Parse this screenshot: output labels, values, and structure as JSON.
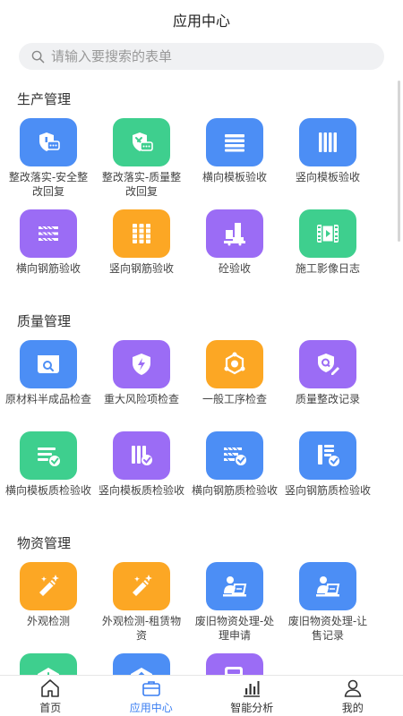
{
  "header": {
    "title": "应用中心"
  },
  "search": {
    "placeholder": "请输入要搜索的表单"
  },
  "sections": [
    {
      "title": "生产管理",
      "items": [
        {
          "label": "整改落实-安全整改回复",
          "icon": "shield-chat-icon",
          "color": "#4c8ef5"
        },
        {
          "label": "整改落实-质量整改回复",
          "icon": "tools-chat-icon",
          "color": "#3ecf8e"
        },
        {
          "label": "横向模板验收",
          "icon": "horizontal-lines-icon",
          "color": "#4c8ef5"
        },
        {
          "label": "竖向模板验收",
          "icon": "vertical-lines-icon",
          "color": "#4c8ef5"
        },
        {
          "label": "横向钢筋验收",
          "icon": "rebar-horizontal-icon",
          "color": "#9b6cf5"
        },
        {
          "label": "竖向钢筋验收",
          "icon": "rebar-vertical-icon",
          "color": "#fca724"
        },
        {
          "label": "砼验收",
          "icon": "concrete-mixer-icon",
          "color": "#9b6cf5"
        },
        {
          "label": "施工影像日志",
          "icon": "film-icon",
          "color": "#3ecf8e"
        }
      ]
    },
    {
      "title": "质量管理",
      "items": [
        {
          "label": "原材料半成品检查",
          "icon": "inspect-box-icon",
          "color": "#4c8ef5"
        },
        {
          "label": "重大风险项检查",
          "icon": "shield-bolt-icon",
          "color": "#9b6cf5"
        },
        {
          "label": "一般工序检查",
          "icon": "hex-nodes-icon",
          "color": "#fca724"
        },
        {
          "label": "质量整改记录",
          "icon": "shield-edit-icon",
          "color": "#9b6cf5"
        },
        {
          "label": "横向模板质检验收",
          "icon": "list-check-icon",
          "color": "#3ecf8e"
        },
        {
          "label": "竖向模板质检验收",
          "icon": "bars-check-icon",
          "color": "#9b6cf5"
        },
        {
          "label": "横向钢筋质检验收",
          "icon": "rebar-check-icon",
          "color": "#4c8ef5"
        },
        {
          "label": "竖向钢筋质检验收",
          "icon": "doc-check-icon",
          "color": "#4c8ef5"
        }
      ]
    },
    {
      "title": "物资管理",
      "items": [
        {
          "label": "外观检测",
          "icon": "magic-wand-icon",
          "color": "#fca724"
        },
        {
          "label": "外观检测-租赁物资",
          "icon": "magic-wand-icon",
          "color": "#fca724"
        },
        {
          "label": "废旧物资处理-处理申请",
          "icon": "person-write-icon",
          "color": "#4c8ef5"
        },
        {
          "label": "废旧物资处理-让售记录",
          "icon": "person-write-icon",
          "color": "#4c8ef5"
        },
        {
          "label": "",
          "icon": "warehouse-in-icon",
          "color": "#3ecf8e"
        },
        {
          "label": "",
          "icon": "warehouse-out-icon",
          "color": "#4c8ef5"
        },
        {
          "label": "",
          "icon": "calculator-icon",
          "color": "#9b6cf5"
        }
      ]
    }
  ],
  "tabbar": {
    "items": [
      {
        "label": "首页",
        "icon": "home-icon",
        "active": false
      },
      {
        "label": "应用中心",
        "icon": "briefcase-icon",
        "active": true
      },
      {
        "label": "智能分析",
        "icon": "bar-chart-icon",
        "active": false
      },
      {
        "label": "我的",
        "icon": "user-icon",
        "active": false
      }
    ],
    "active_color": "#3a7ef2"
  }
}
